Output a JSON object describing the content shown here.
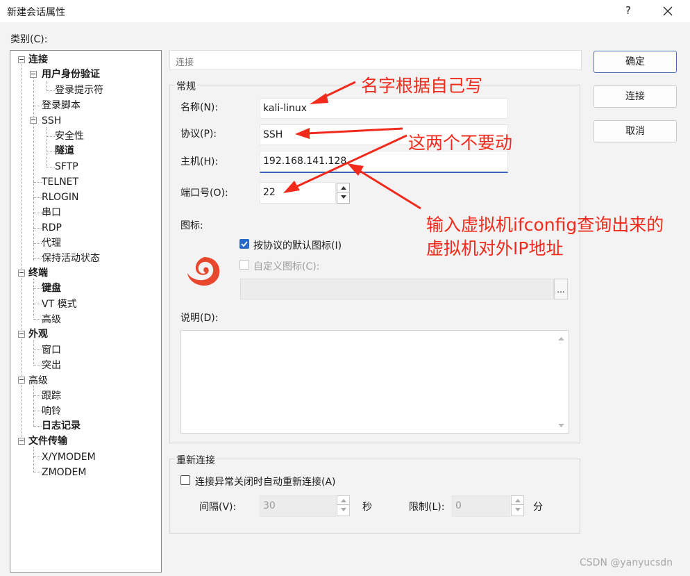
{
  "window": {
    "title": "新建会话属性",
    "help": "?",
    "close_icon": "close-icon"
  },
  "category_label": "类别(C):",
  "tree": {
    "connection": "连接",
    "user_auth": "用户身份验证",
    "login_prompt": "登录提示符",
    "login_script": "登录脚本",
    "ssh": "SSH",
    "security": "安全性",
    "tunnel": "隧道",
    "sftp": "SFTP",
    "telnet": "TELNET",
    "rlogin": "RLOGIN",
    "serial": "串口",
    "rdp": "RDP",
    "proxy": "代理",
    "keepalive": "保持活动状态",
    "terminal": "终端",
    "keyboard": "键盘",
    "vt_mode": "VT 模式",
    "advanced_term": "高级",
    "appearance": "外观",
    "window": "窗口",
    "highlight": "突出",
    "advanced": "高级",
    "trace": "跟踪",
    "bell": "响铃",
    "logging": "日志记录",
    "file_transfer": "文件传输",
    "xymodem": "X/YMODEM",
    "zmodem": "ZMODEM"
  },
  "header": {
    "title": "连接"
  },
  "general": {
    "group_title": "常规",
    "name_label": "名称(N):",
    "name_value": "kali-linux",
    "protocol_label": "协议(P):",
    "protocol_value": "SSH",
    "host_label": "主机(H):",
    "host_value": "192.168.141.128",
    "port_label": "端口号(O):",
    "port_value": "22",
    "icon_label": "图标:",
    "default_icon_label": "按协议的默认图标(I)",
    "default_icon_checked": true,
    "custom_icon_label": "自定义图标(C):",
    "custom_icon_checked": false,
    "browse_label": "...",
    "desc_label": "说明(D):",
    "desc_value": ""
  },
  "reconnect": {
    "group_title": "重新连接",
    "auto_label": "连接异常关闭时自动重新连接(A)",
    "auto_checked": false,
    "interval_label": "间隔(V):",
    "interval_value": "30",
    "interval_unit": "秒",
    "limit_label": "限制(L):",
    "limit_value": "0",
    "limit_unit": "分"
  },
  "buttons": {
    "ok": "确定",
    "connect": "连接",
    "cancel": "取消"
  },
  "annotations": {
    "name_note": "名字根据自己写",
    "dont_touch_note": "这两个不要动",
    "ip_note_line1": "输入虚拟机ifconfig查询出来的",
    "ip_note_line2": "虚拟机对外IP地址",
    "color": "#f22a1c"
  },
  "watermark": "CSDN @yanyucsdn"
}
